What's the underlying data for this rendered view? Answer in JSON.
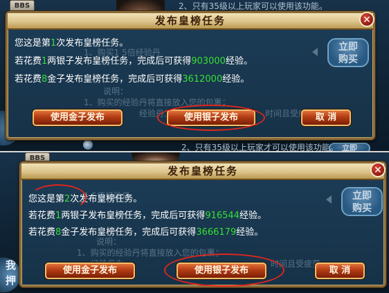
{
  "background": {
    "bbs_tab": "BBS",
    "side_button": "立即购买",
    "side_button_line1": "立即",
    "side_button_line2": "购买",
    "left_tab": "我押",
    "promo_title": "1、购买1 5倍经验丹",
    "promo_title_b": "1 5倍经验丹",
    "desc_label": "说明：",
    "desc_line1": "1、购买的经验丹将直接放入您的包裹；",
    "desc_line2": "经验丹为",
    "desc_line2b": "时间且受疲劳",
    "desc_line3": "2、只有35级以上玩家才可以使用该功能。",
    "desc_line3_partial": "2、只有35级以上玩家才可以使用该功能。"
  },
  "colors": {
    "highlight": "#35e035",
    "ring": "#e0261c",
    "title_text": "#3a1e08"
  },
  "dialogs": [
    {
      "title": "发布皇榜任务",
      "close_icon": "✕",
      "line1_a": "您这是第",
      "line1_n": "1",
      "line1_b": "次发布皇榜任务。",
      "line2_a": "若花费",
      "line2_n": "1",
      "line2_b": "两银子发布皇榜任务，完成后可获得",
      "line2_v": "903000",
      "line2_c": "经验。",
      "line3_a": "若花费",
      "line3_n": "8",
      "line3_b": "金子发布皇榜任务，完成后可获得",
      "line3_v": "3612000",
      "line3_c": "经验。",
      "btn_gold": "使用金子发布",
      "btn_silver": "使用银子发布",
      "btn_cancel": "取  消"
    },
    {
      "title": "发布皇榜任务",
      "close_icon": "✕",
      "line1_a": "您这是第",
      "line1_n": "2",
      "line1_b": "次发布皇榜任务。",
      "line2_a": "若花费",
      "line2_n": "1",
      "line2_b": "两银子发布皇榜任务，完成后可获得",
      "line2_v": "916544",
      "line2_c": "经验。",
      "line3_a": "若花费",
      "line3_n": "8",
      "line3_b": "金子发布皇榜任务，完成后可获得",
      "line3_v": "3666179",
      "line3_c": "经验。",
      "btn_gold": "使用金子发布",
      "btn_silver": "使用银子发布",
      "btn_cancel": "取  消"
    }
  ]
}
